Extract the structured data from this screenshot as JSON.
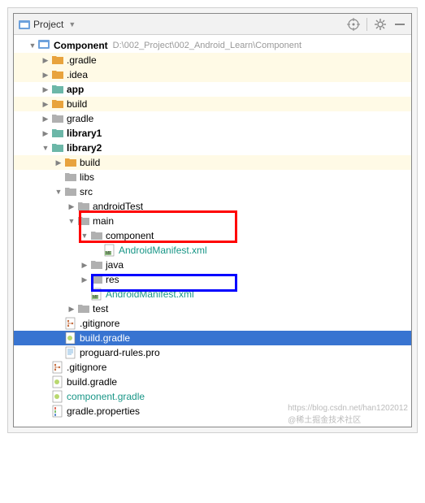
{
  "toolbar": {
    "title": "Project"
  },
  "root": {
    "name": "Component",
    "path": "D:\\002_Project\\002_Android_Learn\\Component"
  },
  "nodes": {
    "gradle_dir": ".gradle",
    "idea_dir": ".idea",
    "app": "app",
    "build": "build",
    "gradle": "gradle",
    "library1": "library1",
    "library2": "library2",
    "lib2_build": "build",
    "lib2_libs": "libs",
    "lib2_src": "src",
    "androidTest": "androidTest",
    "main": "main",
    "component": "component",
    "manifest1": "AndroidManifest.xml",
    "java": "java",
    "res": "res",
    "manifest2": "AndroidManifest.xml",
    "test": "test",
    "gitignore": ".gitignore",
    "build_gradle": "build.gradle",
    "proguard": "proguard-rules.pro",
    "root_gitignore": ".gitignore",
    "root_build_gradle": "build.gradle",
    "component_gradle": "component.gradle",
    "gradle_props": "gradle.properties"
  },
  "annotations": {
    "red_box": "#ff0000",
    "blue_box": "#0000ff"
  },
  "watermarks": {
    "line1": "https://blog.csdn.net/han1202012",
    "line2": "@稀土掘金技术社区"
  }
}
